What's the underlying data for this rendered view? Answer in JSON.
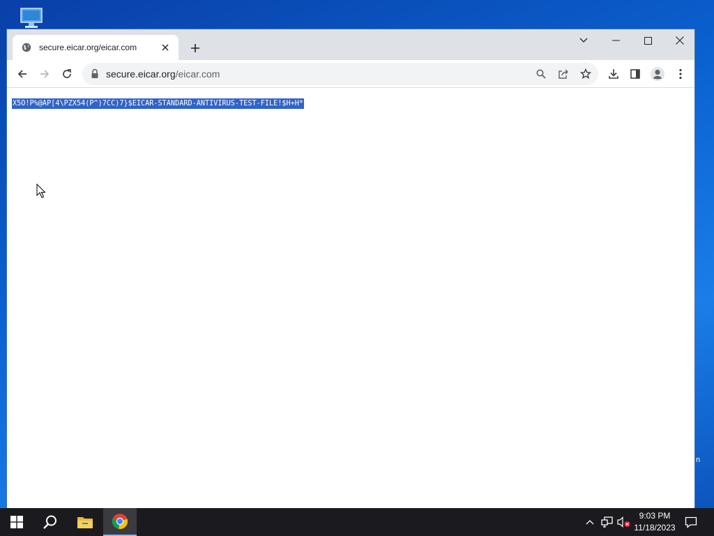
{
  "desktop": {
    "icon": "this-pc-icon",
    "peek_text": "n"
  },
  "browser": {
    "tab": {
      "title": "secure.eicar.org/eicar.com",
      "favicon": "globe-icon"
    },
    "address": {
      "host": "secure.eicar.org",
      "path": "/eicar.com"
    },
    "page": {
      "text": "X5O!P%@AP[4\\PZX54(P^)7CC)7}$EICAR-STANDARD-ANTIVIRUS-TEST-FILE!$H+H*",
      "selected": true
    }
  },
  "taskbar": {
    "time": "9:03 PM",
    "date": "11/18/2023"
  },
  "colors": {
    "selection": "#3163c8",
    "tabstrip": "#dee1e6",
    "taskbar": "#1b1b1f"
  }
}
